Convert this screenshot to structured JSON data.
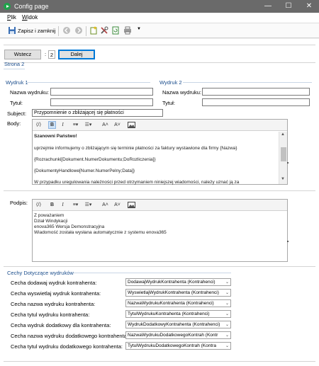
{
  "window": {
    "title": "Config page",
    "minimize": "—",
    "maximize": "☐",
    "close": "✕"
  },
  "menu": {
    "file": "Plik",
    "view": "Widok"
  },
  "toolbar": {
    "save_close": "Zapisz i zamknij"
  },
  "pager": {
    "back": "Wstecz",
    "sep": ":",
    "page": "2",
    "next": "Dalej"
  },
  "page_title": "Strona 2",
  "print1": {
    "title": "Wydruk 1",
    "name_label": "Nazwa wydruku:",
    "name_value": "",
    "title_label": "Tytuł:",
    "title_value": ""
  },
  "print2": {
    "title": "Wydruk 2",
    "name_label": "Nazwa wydruku:",
    "name_value": "",
    "title_label": "Tytuł:",
    "title_value": ""
  },
  "subject": {
    "label": "Subject:",
    "value": "Przypomnienie o zbliżającej się płatności"
  },
  "body": {
    "label": "Body:",
    "lines": [
      "Szanowni Państwo!",
      "uprzejmie informujemy o zbliżającym się terminie płatności za faktury wystawione dla firmy {Nazwa}",
      "{Rozrachunki[Dokument.NumerDokumentu;DoRozliczenia]}",
      "{DokumentyHandlowe[Numer.NumerPelny;Data]}",
      "W przypadku uregulowania należności przed otrzymaniem niniejszej wiadomości, należy uznać ją za"
    ]
  },
  "signature": {
    "label": "Podpis:",
    "lines": [
      "Z poważaniem",
      "Dział Windykacji",
      "enova365 Wersja Demonstracyjna",
      "Wiadomość została wysłana automatycznie z systemu enova365"
    ]
  },
  "features": {
    "title": "Cechy Dotyczące wydruków",
    "rows": [
      {
        "label": "Cecha dodawaj wydruk kontrahenta:",
        "value": "DodawajWydrukKontrahenta (Kontrahenci)"
      },
      {
        "label": "Cecha wyswietlaj wydruk kontrahenta:",
        "value": "WyswietlajWydrukKontrahenta (Kontrahenci)"
      },
      {
        "label": "Cecha nazwa wydruku kontrahenta:",
        "value": "NazwaWydrukuKontrahenta (Kontrahenci)"
      },
      {
        "label": "Cecha tytul wydruku kontrahenta:",
        "value": "TytulWydrukuKontrahenta (Kontrahenci)"
      },
      {
        "label": "Cecha wydruk dodatkowy dla kontrahenta:",
        "value": "WydrukDodatkowyKontrahenta (Kontrahenci)"
      },
      {
        "label": "Cecha nazwa wydruku dodatkowego kontrahenta:",
        "value": "NazwaWydrukuDodatkowegoKontrah (Kontr"
      },
      {
        "label": "Cecha tytul wydruku dodatkowego kontrahenta:",
        "value": "TytulWydrukuDodatkowegoKontrah (Kontra"
      }
    ]
  },
  "colors": {
    "titlebar": "#6a6a6a",
    "accent": "#0078d7",
    "section": "#1a4d8c"
  },
  "editor_icons": [
    "html-source-icon",
    "bold-icon",
    "italic-icon",
    "align-icon",
    "list-icon",
    "font-grow-icon",
    "font-shrink-icon",
    "image-icon"
  ]
}
